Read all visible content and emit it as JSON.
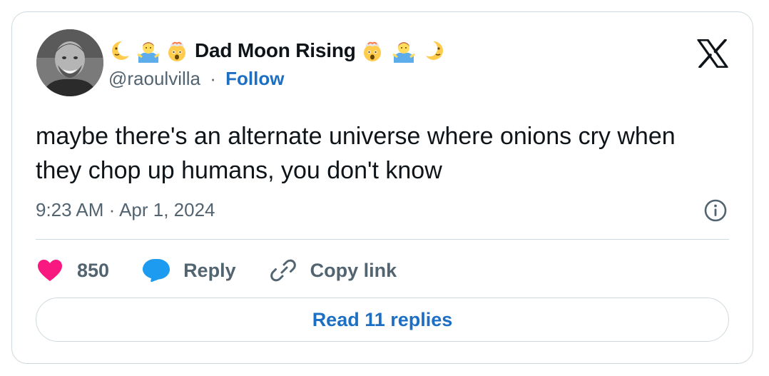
{
  "author": {
    "display_name": "Dad Moon Rising",
    "handle": "@raoulvilla",
    "separator": "·",
    "follow_label": "Follow",
    "name_emojis_left": [
      "crescent-moon-face-icon",
      "person-shrugging-icon",
      "exploding-head-icon"
    ],
    "name_emojis_right": [
      "exploding-head-icon",
      "person-shrugging-icon",
      "crescent-moon-face-icon"
    ]
  },
  "tweet": {
    "text": "maybe there's an alternate universe where onions cry when they chop up humans, you don't know",
    "timestamp": "9:23 AM · Apr 1, 2024"
  },
  "actions": {
    "like_count": "850",
    "reply_label": "Reply",
    "copy_link_label": "Copy link"
  },
  "read_replies_label": "Read 11 replies",
  "colors": {
    "link_blue": "#1d6fc4",
    "like_pink": "#f91880",
    "reply_blue": "#1d9bf0",
    "muted_text": "#536471",
    "border": "#cfd9de"
  }
}
